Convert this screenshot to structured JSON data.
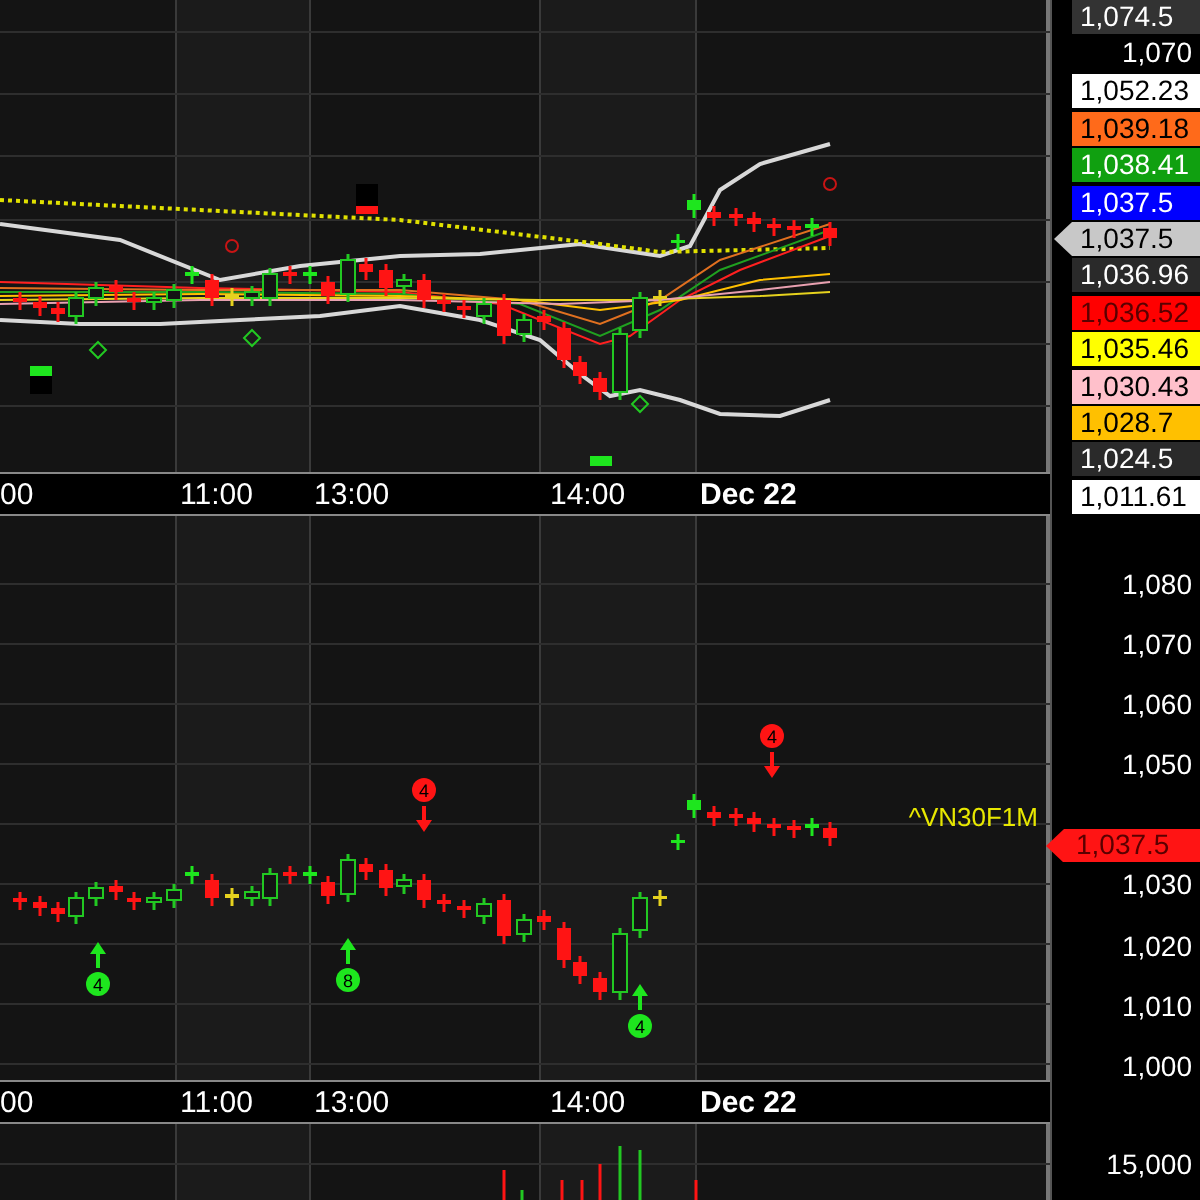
{
  "price_pane": {
    "axis_labels": [
      {
        "text": "1,074.5",
        "kind": "box",
        "color": "#333333"
      },
      {
        "text": "1,070",
        "kind": "plain"
      },
      {
        "text": "1,052.23",
        "kind": "box",
        "color": "#ffffff"
      },
      {
        "text": "1,039.18",
        "kind": "box",
        "color": "#ff6a1a"
      },
      {
        "text": "1,038.41",
        "kind": "box",
        "color": "#10a010"
      },
      {
        "text": "1,037.5",
        "kind": "box",
        "color": "#0000ff"
      },
      {
        "text": "1,037.5",
        "kind": "pointer",
        "color": "#c8c8c8"
      },
      {
        "text": "1,036.96",
        "kind": "box",
        "color": "#2a2a2a"
      },
      {
        "text": "1,036.52",
        "kind": "box",
        "color": "#ff0000"
      },
      {
        "text": "1,035.46",
        "kind": "box",
        "color": "#ffff00"
      },
      {
        "text": "1,030.43",
        "kind": "box",
        "color": "#ffc0cb"
      },
      {
        "text": "1,028.7",
        "kind": "box",
        "color": "#ffc000"
      },
      {
        "text": "1,024.5",
        "kind": "box",
        "color": "#2a2a2a"
      },
      {
        "text": "1,011.61",
        "kind": "box",
        "color": "#ffffff"
      }
    ]
  },
  "time_axis_top": {
    "labels": [
      {
        "text": "00",
        "kind": "time"
      },
      {
        "text": "11:00",
        "kind": "time"
      },
      {
        "text": "13:00",
        "kind": "time"
      },
      {
        "text": "14:00",
        "kind": "time"
      },
      {
        "text": "Dec 22",
        "kind": "date"
      }
    ]
  },
  "candle_pane": {
    "symbol": "^VN30F1M",
    "axis_ticks": [
      {
        "text": "1,080",
        "kind": "tick"
      },
      {
        "text": "1,070",
        "kind": "tick"
      },
      {
        "text": "1,060",
        "kind": "tick"
      },
      {
        "text": "1,050",
        "kind": "tick"
      },
      {
        "text": "1,037.5",
        "kind": "tag"
      },
      {
        "text": "1,030",
        "kind": "tick"
      },
      {
        "text": "1,020",
        "kind": "tick"
      },
      {
        "text": "1,010",
        "kind": "tick"
      },
      {
        "text": "1,000",
        "kind": "tick"
      }
    ],
    "signals": [
      {
        "label": "4",
        "kind": "buy"
      },
      {
        "label": "8",
        "kind": "buy"
      },
      {
        "label": "4",
        "kind": "sell"
      },
      {
        "label": "4",
        "kind": "buy"
      },
      {
        "label": "4",
        "kind": "sell"
      }
    ]
  },
  "time_axis_bottom": {
    "labels": [
      {
        "text": "00",
        "kind": "time"
      },
      {
        "text": "11:00",
        "kind": "time"
      },
      {
        "text": "13:00",
        "kind": "time"
      },
      {
        "text": "14:00",
        "kind": "time"
      },
      {
        "text": "Dec 22",
        "kind": "date"
      }
    ]
  },
  "volume_pane": {
    "axis_ticks": [
      "15,000"
    ]
  }
}
